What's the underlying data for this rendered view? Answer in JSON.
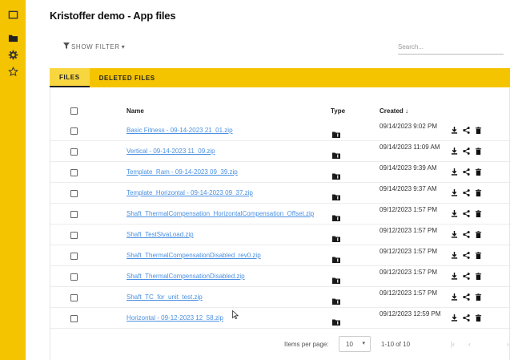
{
  "title": "Kristoffer demo - App files",
  "rail": {
    "items": [
      {
        "icon": "square-icon"
      },
      {
        "icon": "folder-icon"
      },
      {
        "icon": "gear-icon"
      },
      {
        "icon": "star-icon"
      }
    ]
  },
  "filter": {
    "label": "SHOW FILTER",
    "caret": "▾"
  },
  "search": {
    "placeholder": "Search..."
  },
  "tabs": [
    {
      "label": "FILES",
      "active": true
    },
    {
      "label": "DELETED FILES",
      "active": false
    }
  ],
  "table": {
    "columns": {
      "name": "Name",
      "type": "Type",
      "created": "Created ↓"
    },
    "rows": [
      {
        "name": "Basic Fitness - 09-14-2023 21_01.zip",
        "created": "09/14/2023 9:02 PM"
      },
      {
        "name": "Vertical - 09-14-2023 11_09.zip",
        "created": "09/14/2023 11:09 AM"
      },
      {
        "name": "Template_Ram - 09-14-2023 09_39.zip",
        "created": "09/14/2023 9:39 AM"
      },
      {
        "name": "Template_Horizontal - 09-14-2023 09_37.zip",
        "created": "09/14/2023 9:37 AM"
      },
      {
        "name": "Shaft_ThermalCompensation_HorizontalCompensation_Offset.zip",
        "created": "09/12/2023 1:57 PM"
      },
      {
        "name": "Shaft_TestSlvaLoad.zip",
        "created": "09/12/2023 1:57 PM"
      },
      {
        "name": "Shaft_ThermalCompensationDisabled_rev0.zip",
        "created": "09/12/2023 1:57 PM"
      },
      {
        "name": "Shaft_ThermalCompensationDisabled.zip",
        "created": "09/12/2023 1:57 PM"
      },
      {
        "name": "Shaft_TC_for_unit_test.zip",
        "created": "09/12/2023 1:57 PM"
      },
      {
        "name": "Horizontal - 09-12-2023 12_58.zip",
        "created": "09/12/2023 12:59 PM"
      }
    ]
  },
  "pager": {
    "items_per_page_label": "Items per page:",
    "items_per_page_value": "10",
    "range": "1-10 of 10",
    "first": "|‹",
    "prev": "‹",
    "next": "›"
  },
  "colors": {
    "accent": "#f5c400",
    "link": "#4a90e2"
  }
}
